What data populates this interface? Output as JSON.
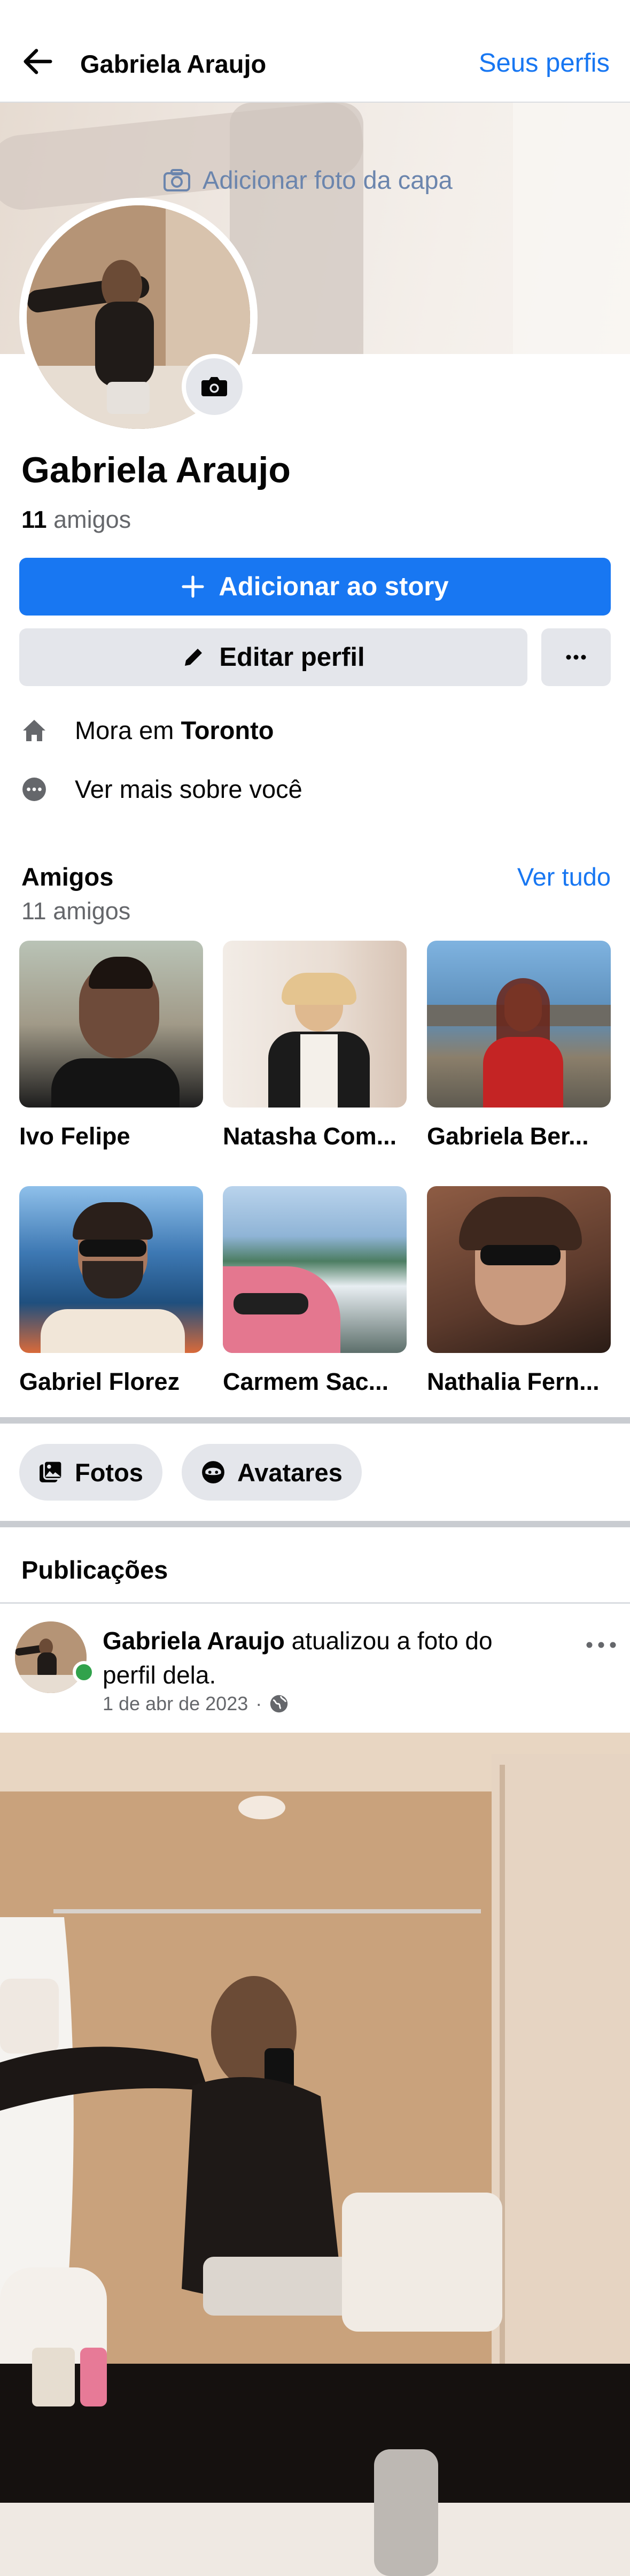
{
  "header": {
    "title": "Gabriela Araujo",
    "right_link": "Seus perfis"
  },
  "cover": {
    "add_photo_label": "Adicionar foto da capa"
  },
  "profile": {
    "name": "Gabriela Araujo",
    "friends_count": "11",
    "friends_word": "amigos"
  },
  "buttons": {
    "add_story": "Adicionar ao story",
    "edit_profile": "Editar perfil"
  },
  "info": {
    "lives_prefix": "Mora em",
    "lives_city": "Toronto",
    "see_more": "Ver mais sobre você"
  },
  "friends_section": {
    "title": "Amigos",
    "subtitle": "11 amigos",
    "see_all": "Ver tudo",
    "friends": [
      {
        "name": "Ivo Felipe",
        "color": "#6b4a3a"
      },
      {
        "name": "Natasha Com...",
        "color": "#d9cfc7"
      },
      {
        "name": "Gabriela Ber...",
        "color": "#4f7fb0"
      },
      {
        "name": "Gabriel Florez",
        "color": "#2f5d88"
      },
      {
        "name": "Carmem Sac...",
        "color": "#7fa3c4"
      },
      {
        "name": "Nathalia Fern...",
        "color": "#5a3b2e"
      }
    ]
  },
  "chips": {
    "photos": "Fotos",
    "avatars": "Avatares"
  },
  "posts_section": {
    "title": "Publicações"
  },
  "post": {
    "author": "Gabriela Araujo",
    "action": "atualizou a foto do perfil dela.",
    "date": "1 de abr de 2023",
    "separator": "·"
  },
  "colors": {
    "accent": "#1877f2",
    "online": "#31a24c",
    "button_gray": "#e4e6eb"
  }
}
